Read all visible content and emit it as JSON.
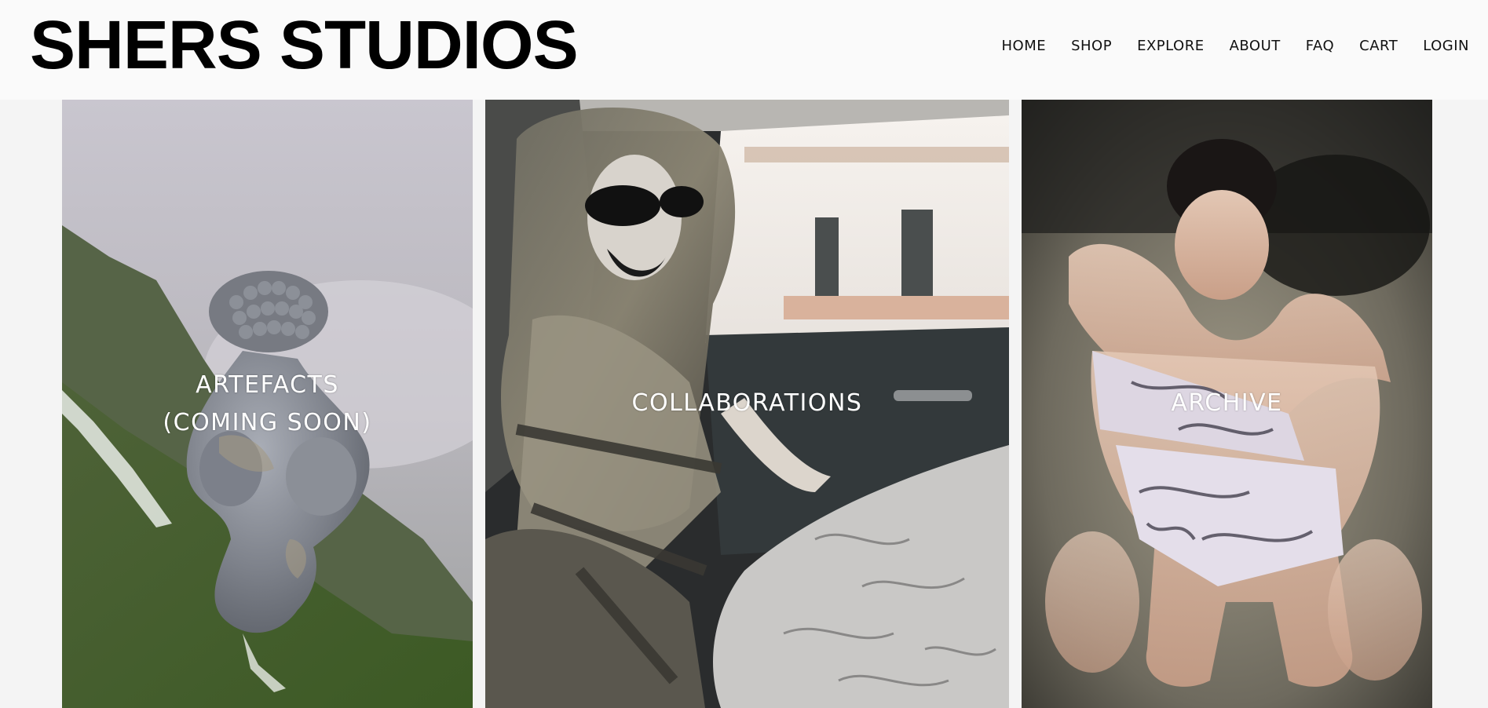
{
  "brand": {
    "name": "SHERS STUDIOS"
  },
  "nav": {
    "items": [
      {
        "label": "HOME"
      },
      {
        "label": "SHOP"
      },
      {
        "label": "EXPLORE"
      },
      {
        "label": "ABOUT"
      },
      {
        "label": "FAQ"
      },
      {
        "label": "CART"
      },
      {
        "label": "LOGIN"
      }
    ]
  },
  "panels": [
    {
      "line1": "ARTEFACTS",
      "line2": "(COMING SOON)"
    },
    {
      "line1": "COLLABORATIONS"
    },
    {
      "line1": "ARCHIVE"
    }
  ]
}
